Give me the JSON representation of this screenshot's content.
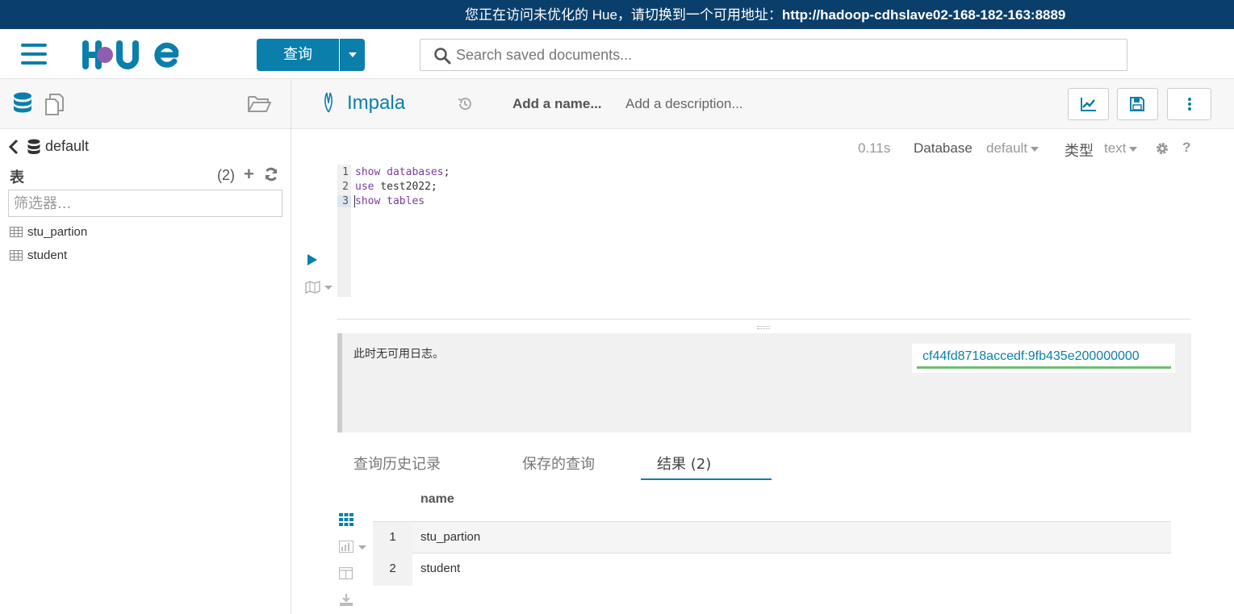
{
  "banner": {
    "text": "您正在访问未优化的 Hue，请切换到一个可用地址：",
    "url": "http://hadoop-cdhslave02-168-182-163:8889"
  },
  "header": {
    "query_button": "查询",
    "search_placeholder": "Search saved documents..."
  },
  "sidebar": {
    "database": "default",
    "tables_label": "表",
    "tables_count": "(2)",
    "filter_placeholder": "筛选器...",
    "tables": [
      "stu_partion",
      "student"
    ]
  },
  "editor": {
    "engine": "Impala",
    "name_placeholder": "Add a name...",
    "description_placeholder": "Add a description...",
    "exec_time": "0.11s",
    "database_label": "Database",
    "database_value": "default",
    "type_label": "类型",
    "type_value": "text",
    "lines": [
      {
        "n": "1",
        "kw": "show databases",
        "rest": ";"
      },
      {
        "n": "2",
        "kw": "use",
        "rest": " test2022;"
      },
      {
        "n": "3",
        "kw": "show tables",
        "rest": ""
      }
    ]
  },
  "log": {
    "text": "此时无可用日志。",
    "query_id": "cf44fd8718accedf:9fb435e200000000"
  },
  "tabs": [
    {
      "label": "查询历史记录"
    },
    {
      "label": "保存的查询"
    },
    {
      "label": "结果 (2)"
    }
  ],
  "results": {
    "column": "name",
    "rows": [
      {
        "idx": "1",
        "value": "stu_partion"
      },
      {
        "idx": "2",
        "value": "student"
      }
    ]
  },
  "colors": {
    "banner_bg": "#0b3f6b",
    "accent": "#0b7fab",
    "query_id_underline": "#6fbf73"
  }
}
